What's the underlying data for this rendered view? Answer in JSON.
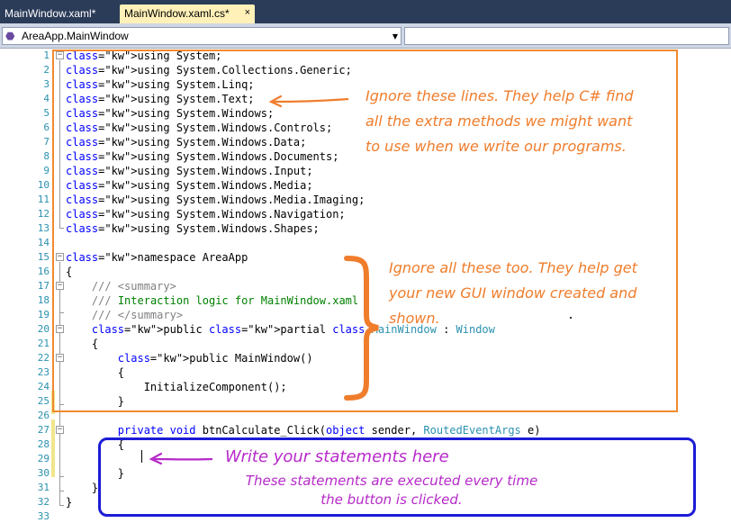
{
  "tabs": [
    {
      "label": "MainWindow.xaml*",
      "active": false
    },
    {
      "label": "MainWindow.xaml.cs*",
      "active": true,
      "close": "×"
    }
  ],
  "navbar": {
    "class_combo": "AreaApp.MainWindow",
    "class_icon": "class-icon",
    "member_combo": ""
  },
  "code_lines": [
    {
      "n": "1",
      "t": "using System;"
    },
    {
      "n": "2",
      "t": "using System.Collections.Generic;"
    },
    {
      "n": "3",
      "t": "using System.Linq;"
    },
    {
      "n": "4",
      "t": "using System.Text;"
    },
    {
      "n": "5",
      "t": "using System.Windows;"
    },
    {
      "n": "6",
      "t": "using System.Windows.Controls;"
    },
    {
      "n": "7",
      "t": "using System.Windows.Data;"
    },
    {
      "n": "8",
      "t": "using System.Windows.Documents;"
    },
    {
      "n": "9",
      "t": "using System.Windows.Input;"
    },
    {
      "n": "10",
      "t": "using System.Windows.Media;"
    },
    {
      "n": "11",
      "t": "using System.Windows.Media.Imaging;"
    },
    {
      "n": "12",
      "t": "using System.Windows.Navigation;"
    },
    {
      "n": "13",
      "t": "using System.Windows.Shapes;"
    },
    {
      "n": "14",
      "t": ""
    },
    {
      "n": "15",
      "t": "namespace AreaApp"
    },
    {
      "n": "16",
      "t": "{"
    },
    {
      "n": "17",
      "t": "    /// <summary>"
    },
    {
      "n": "18",
      "t": "    /// Interaction logic for MainWindow.xaml"
    },
    {
      "n": "19",
      "t": "    /// </summary>"
    },
    {
      "n": "20",
      "t": "    public partial class MainWindow : Window"
    },
    {
      "n": "21",
      "t": "    {"
    },
    {
      "n": "22",
      "t": "        public MainWindow()"
    },
    {
      "n": "23",
      "t": "        {"
    },
    {
      "n": "24",
      "t": "            InitializeComponent();"
    },
    {
      "n": "25",
      "t": "        }"
    },
    {
      "n": "26",
      "t": ""
    },
    {
      "n": "27",
      "t": "        private void btnCalculate_Click(object sender, RoutedEventArgs e)"
    },
    {
      "n": "28",
      "t": "        {"
    },
    {
      "n": "29",
      "t": ""
    },
    {
      "n": "30",
      "t": "        }"
    },
    {
      "n": "31",
      "t": "    }"
    },
    {
      "n": "32",
      "t": "}"
    },
    {
      "n": "33",
      "t": ""
    }
  ],
  "annotations": {
    "note1": [
      "Ignore these lines.  They help C# find",
      "all the extra methods we might want",
      "to use when we write our programs."
    ],
    "note2": [
      "Ignore all these too.  They help get",
      "your new GUI window created and",
      "shown."
    ],
    "note3_title": "Write your statements here",
    "note3_body": [
      "These statements are executed every time",
      "the button is clicked."
    ]
  },
  "colors": {
    "keyword": "#0000ff",
    "type": "#2b91af",
    "comment": "#008000",
    "annotation_orange": "#ef7d2c",
    "annotation_magenta": "#b62ac9",
    "annotation_blue": "#1c1cd6"
  }
}
